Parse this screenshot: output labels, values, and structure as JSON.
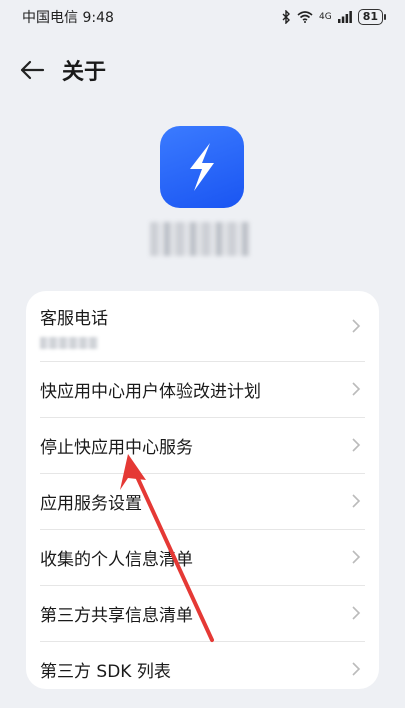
{
  "status_bar": {
    "carrier_time": "中国电信 9:48",
    "network": "4G",
    "battery": "81",
    "icons": [
      "bluetooth-icon",
      "wifi-icon",
      "signal-icon",
      "battery-icon"
    ]
  },
  "header": {
    "title": "关于"
  },
  "app": {
    "icon": "lightning-icon",
    "accent": "#2563f5"
  },
  "menu": {
    "items": [
      {
        "label": "客服电话"
      },
      {
        "label": "快应用中心用户体验改进计划"
      },
      {
        "label": "停止快应用中心服务"
      },
      {
        "label": "应用服务设置"
      },
      {
        "label": "收集的个人信息清单"
      },
      {
        "label": "第三方共享信息清单"
      },
      {
        "label": "第三方 SDK 列表"
      }
    ]
  },
  "annotation": {
    "color": "#e53935",
    "target": "停止快应用中心服务"
  }
}
